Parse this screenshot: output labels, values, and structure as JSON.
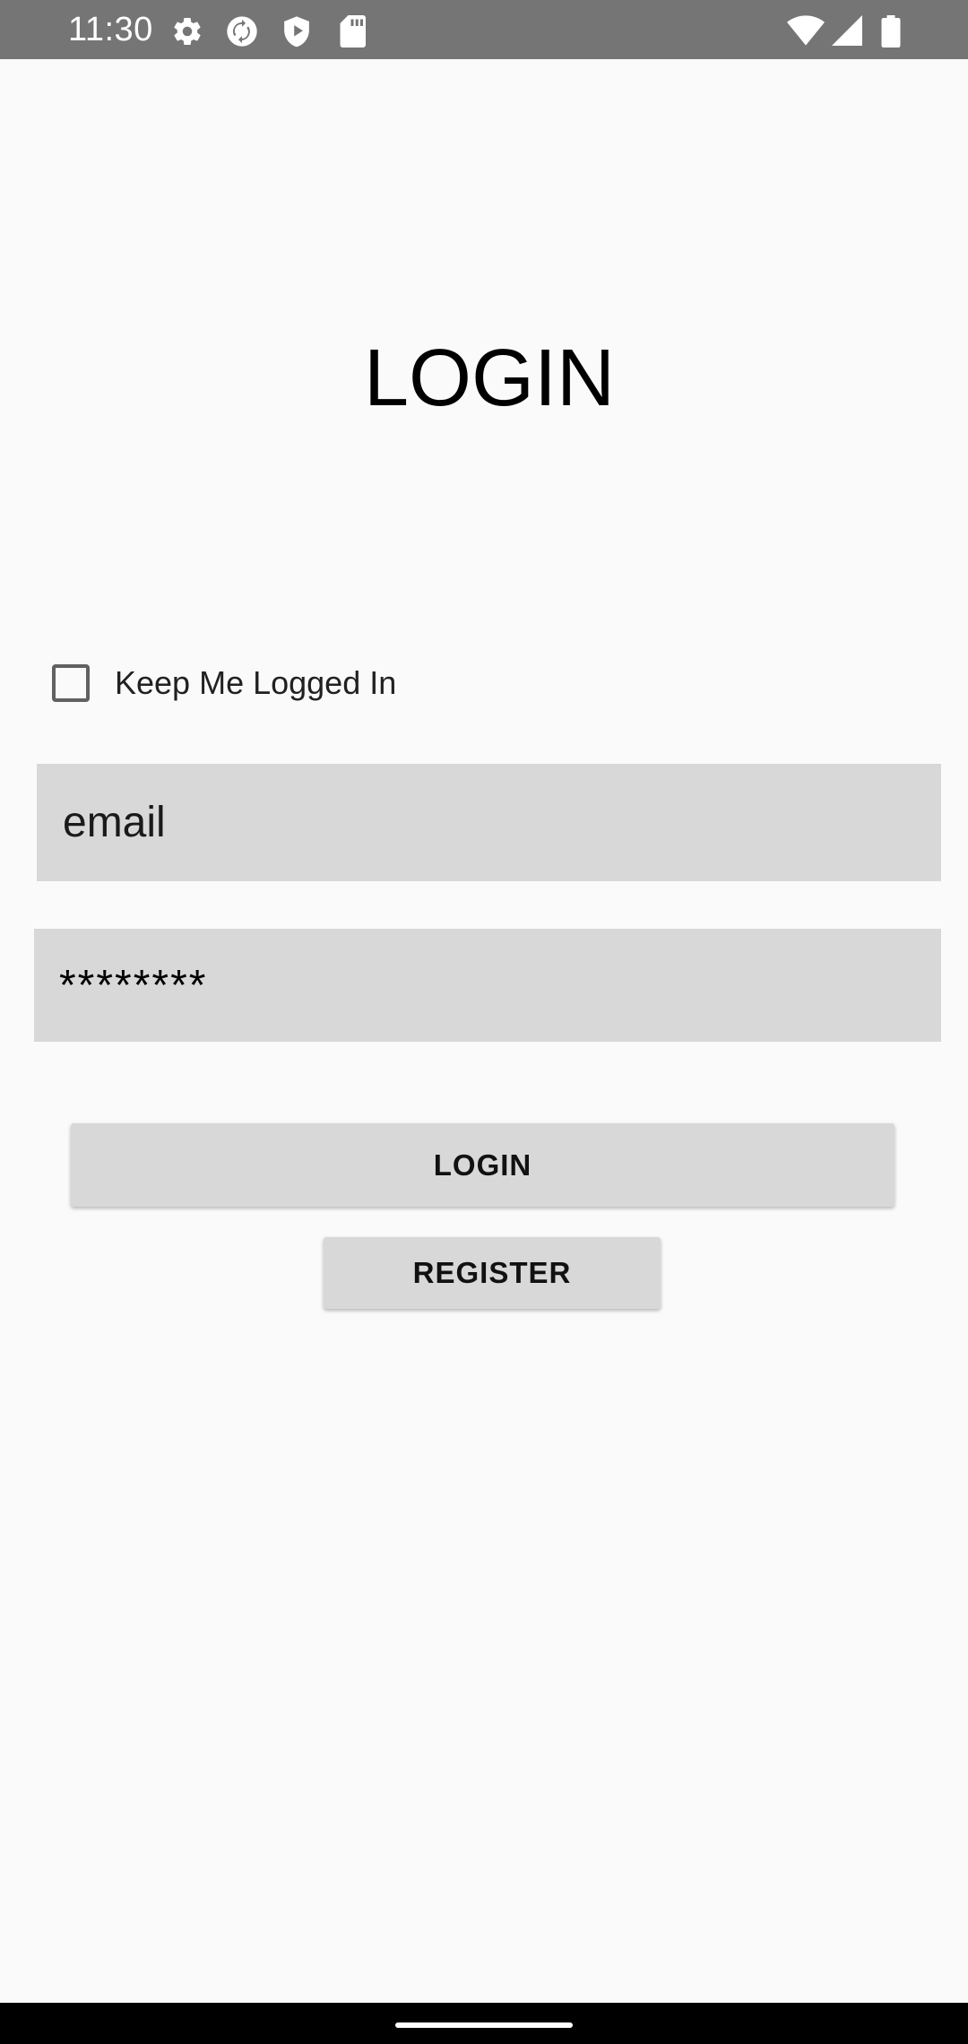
{
  "status_bar": {
    "time": "11:30",
    "left_icons": [
      "settings-gear-icon",
      "sync-icon",
      "shield-icon",
      "sd-card-icon"
    ],
    "right_icons": [
      "wifi-icon",
      "cellular-signal-icon",
      "battery-icon"
    ],
    "background_color": "#757575"
  },
  "screen": {
    "title": "LOGIN",
    "background_color": "#fafafa"
  },
  "form": {
    "keep_logged_in_label": "Keep Me Logged In",
    "keep_logged_in_checked": false,
    "email_placeholder": "email",
    "email_value": "",
    "password_value": "********",
    "field_color": "#d8d8d8"
  },
  "buttons": {
    "login_label": "LOGIN",
    "register_label": "REGISTER"
  }
}
